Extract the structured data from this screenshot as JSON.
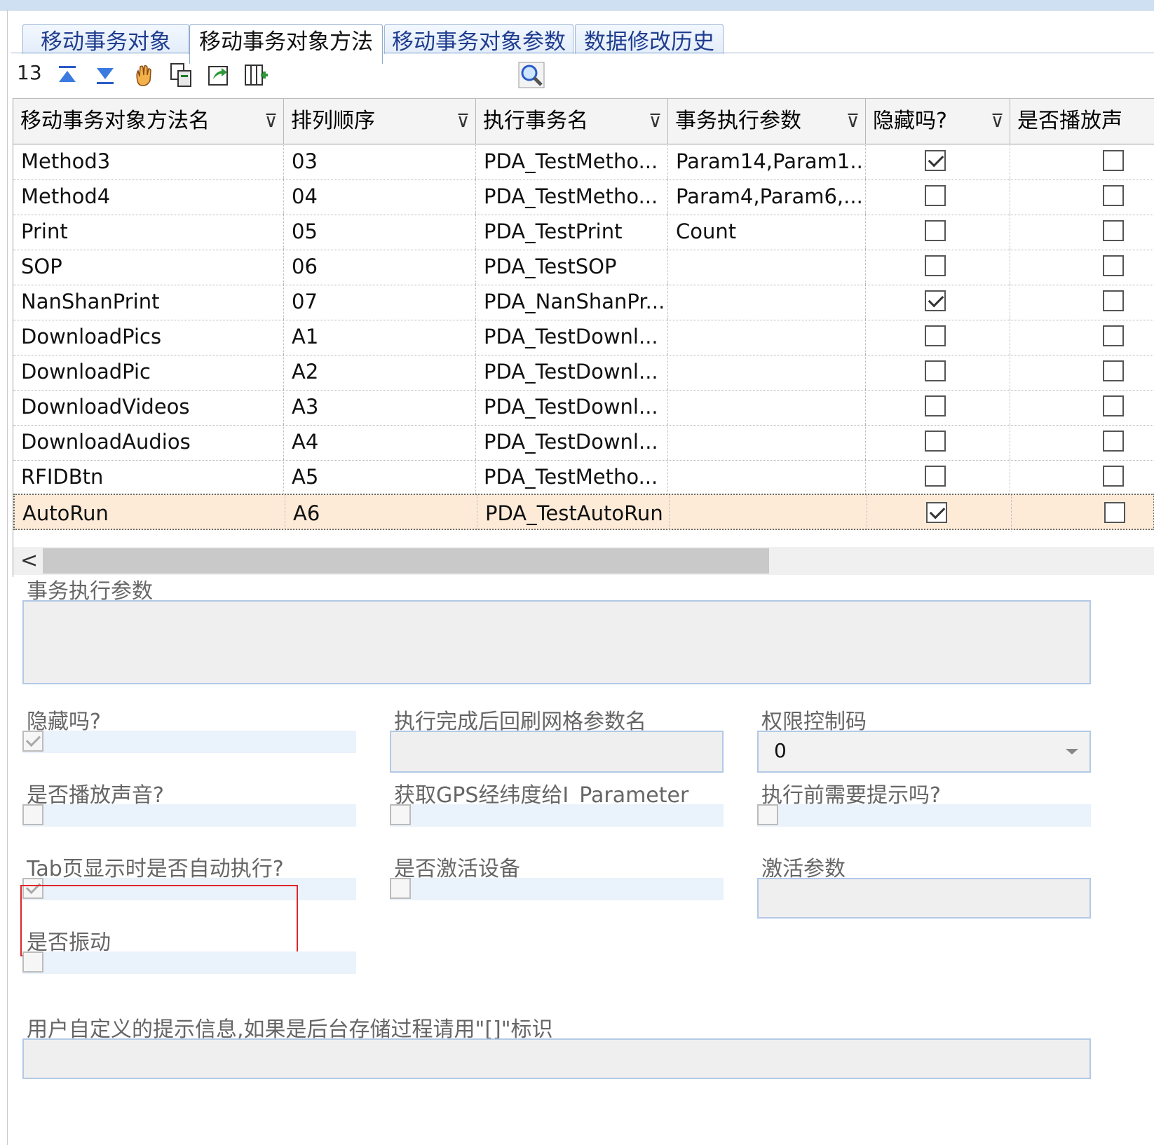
{
  "tabs": [
    {
      "label": "移动事务对象",
      "active": false
    },
    {
      "label": "移动事务对象方法",
      "active": true
    },
    {
      "label": "移动事务对象参数",
      "active": false
    },
    {
      "label": "数据修改历史",
      "active": false
    }
  ],
  "toolbar": {
    "record_count": "13",
    "icons": [
      "move-first-icon",
      "move-last-icon",
      "hand-icon",
      "copy-icon",
      "export-icon",
      "column-add-icon",
      "search-icon"
    ]
  },
  "grid": {
    "columns": [
      "移动事务对象方法名",
      "排列顺序",
      "执行事务名",
      "事务执行参数",
      "隐藏吗?",
      "是否播放声"
    ],
    "rows": [
      {
        "name": "Method3",
        "order": "03",
        "exec": "PDA_TestMetho...",
        "param": "Param14,Param1...",
        "hidden": true,
        "sound": false
      },
      {
        "name": "Method4",
        "order": "04",
        "exec": "PDA_TestMetho...",
        "param": "Param4,Param6,...",
        "hidden": false,
        "sound": false
      },
      {
        "name": "Print",
        "order": "05",
        "exec": "PDA_TestPrint",
        "param": "Count",
        "hidden": false,
        "sound": false
      },
      {
        "name": "SOP",
        "order": "06",
        "exec": "PDA_TestSOP",
        "param": "",
        "hidden": false,
        "sound": false
      },
      {
        "name": "NanShanPrint",
        "order": "07",
        "exec": "PDA_NanShanPr...",
        "param": "",
        "hidden": true,
        "sound": false
      },
      {
        "name": "DownloadPics",
        "order": "A1",
        "exec": "PDA_TestDownl...",
        "param": "",
        "hidden": false,
        "sound": false
      },
      {
        "name": "DownloadPic",
        "order": "A2",
        "exec": "PDA_TestDownl...",
        "param": "",
        "hidden": false,
        "sound": false
      },
      {
        "name": "DownloadVideos",
        "order": "A3",
        "exec": "PDA_TestDownl...",
        "param": "",
        "hidden": false,
        "sound": false
      },
      {
        "name": "DownloadAudios",
        "order": "A4",
        "exec": "PDA_TestDownl...",
        "param": "",
        "hidden": false,
        "sound": false
      },
      {
        "name": "RFIDBtn",
        "order": "A5",
        "exec": "PDA_TestMetho...",
        "param": "",
        "hidden": false,
        "sound": false
      },
      {
        "name": "AutoRun",
        "order": "A6",
        "exec": "PDA_TestAutoRun",
        "param": "",
        "hidden": true,
        "sound": false,
        "selected": true
      }
    ],
    "scroll_left": "<"
  },
  "form": {
    "exec_params_label": "事务执行参数",
    "exec_params_value": "",
    "hidden_label": "隐藏吗?",
    "hidden_checked": true,
    "refresh_param_label": "执行完成后回刷网格参数名",
    "refresh_param_value": "",
    "permission_label": "权限控制码",
    "permission_value": "0",
    "play_sound_label": "是否播放声音?",
    "play_sound_checked": false,
    "gps_label": "获取GPS经纬度给I_Parameter",
    "gps_checked": false,
    "prompt_before_label": "执行前需要提示吗?",
    "prompt_before_checked": false,
    "auto_exec_label": "Tab页显示时是否自动执行?",
    "auto_exec_checked": true,
    "activate_device_label": "是否激活设备",
    "activate_device_checked": false,
    "activate_params_label": "激活参数",
    "activate_params_value": "",
    "vibrate_label": "是否振动",
    "vibrate_checked": false,
    "custom_prompt_label": "用户自定义的提示信息,如果是后台存储过程请用\"[]\"标识",
    "custom_prompt_value": ""
  },
  "colors": {
    "highlight_border": "#e0262b",
    "selected_row": "#fdebd8",
    "tab_text": "#1f3d8f"
  }
}
